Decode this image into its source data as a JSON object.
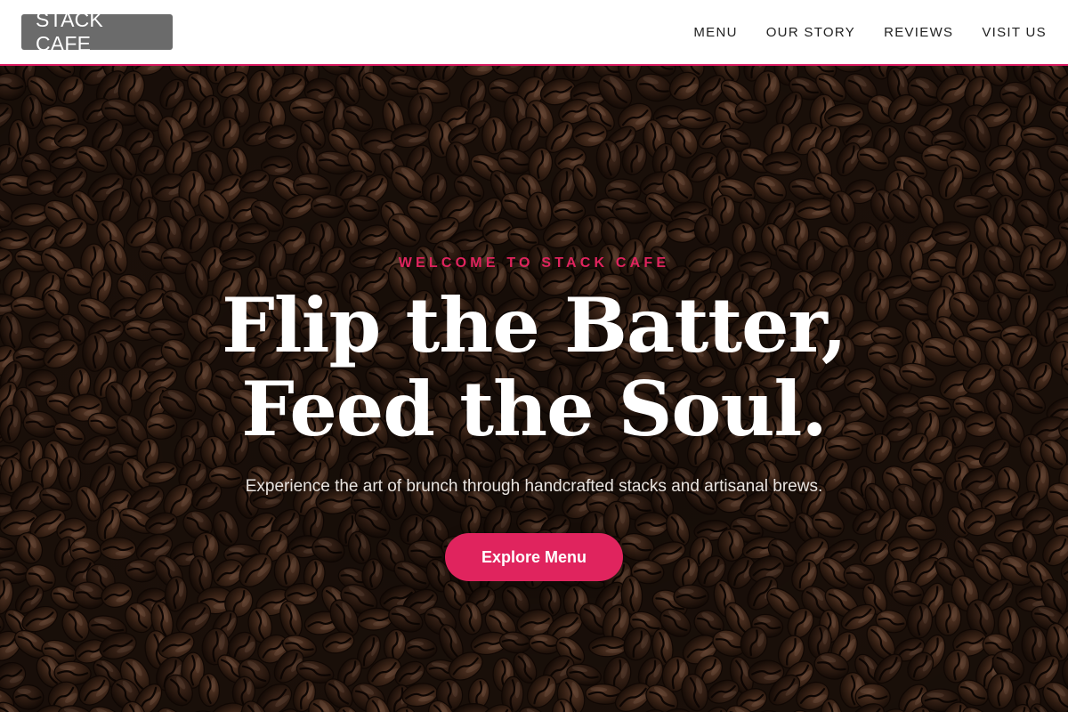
{
  "brand": {
    "logo_text": "STACK CAFE",
    "accent_color": "#e0245e",
    "logo_bg_color": "#6b6b6b"
  },
  "nav": {
    "items": [
      {
        "label": "MENU"
      },
      {
        "label": "OUR STORY"
      },
      {
        "label": "REVIEWS"
      },
      {
        "label": "VISIT US"
      }
    ]
  },
  "hero": {
    "background": "coffee-beans-photo",
    "eyebrow": "WELCOME TO STACK CAFE",
    "headline_line1": "Flip the Batter,",
    "headline_line2": "Feed the Soul.",
    "subtitle": "Experience the art of brunch through handcrafted stacks and artisanal brews.",
    "cta_label": "Explore Menu"
  }
}
